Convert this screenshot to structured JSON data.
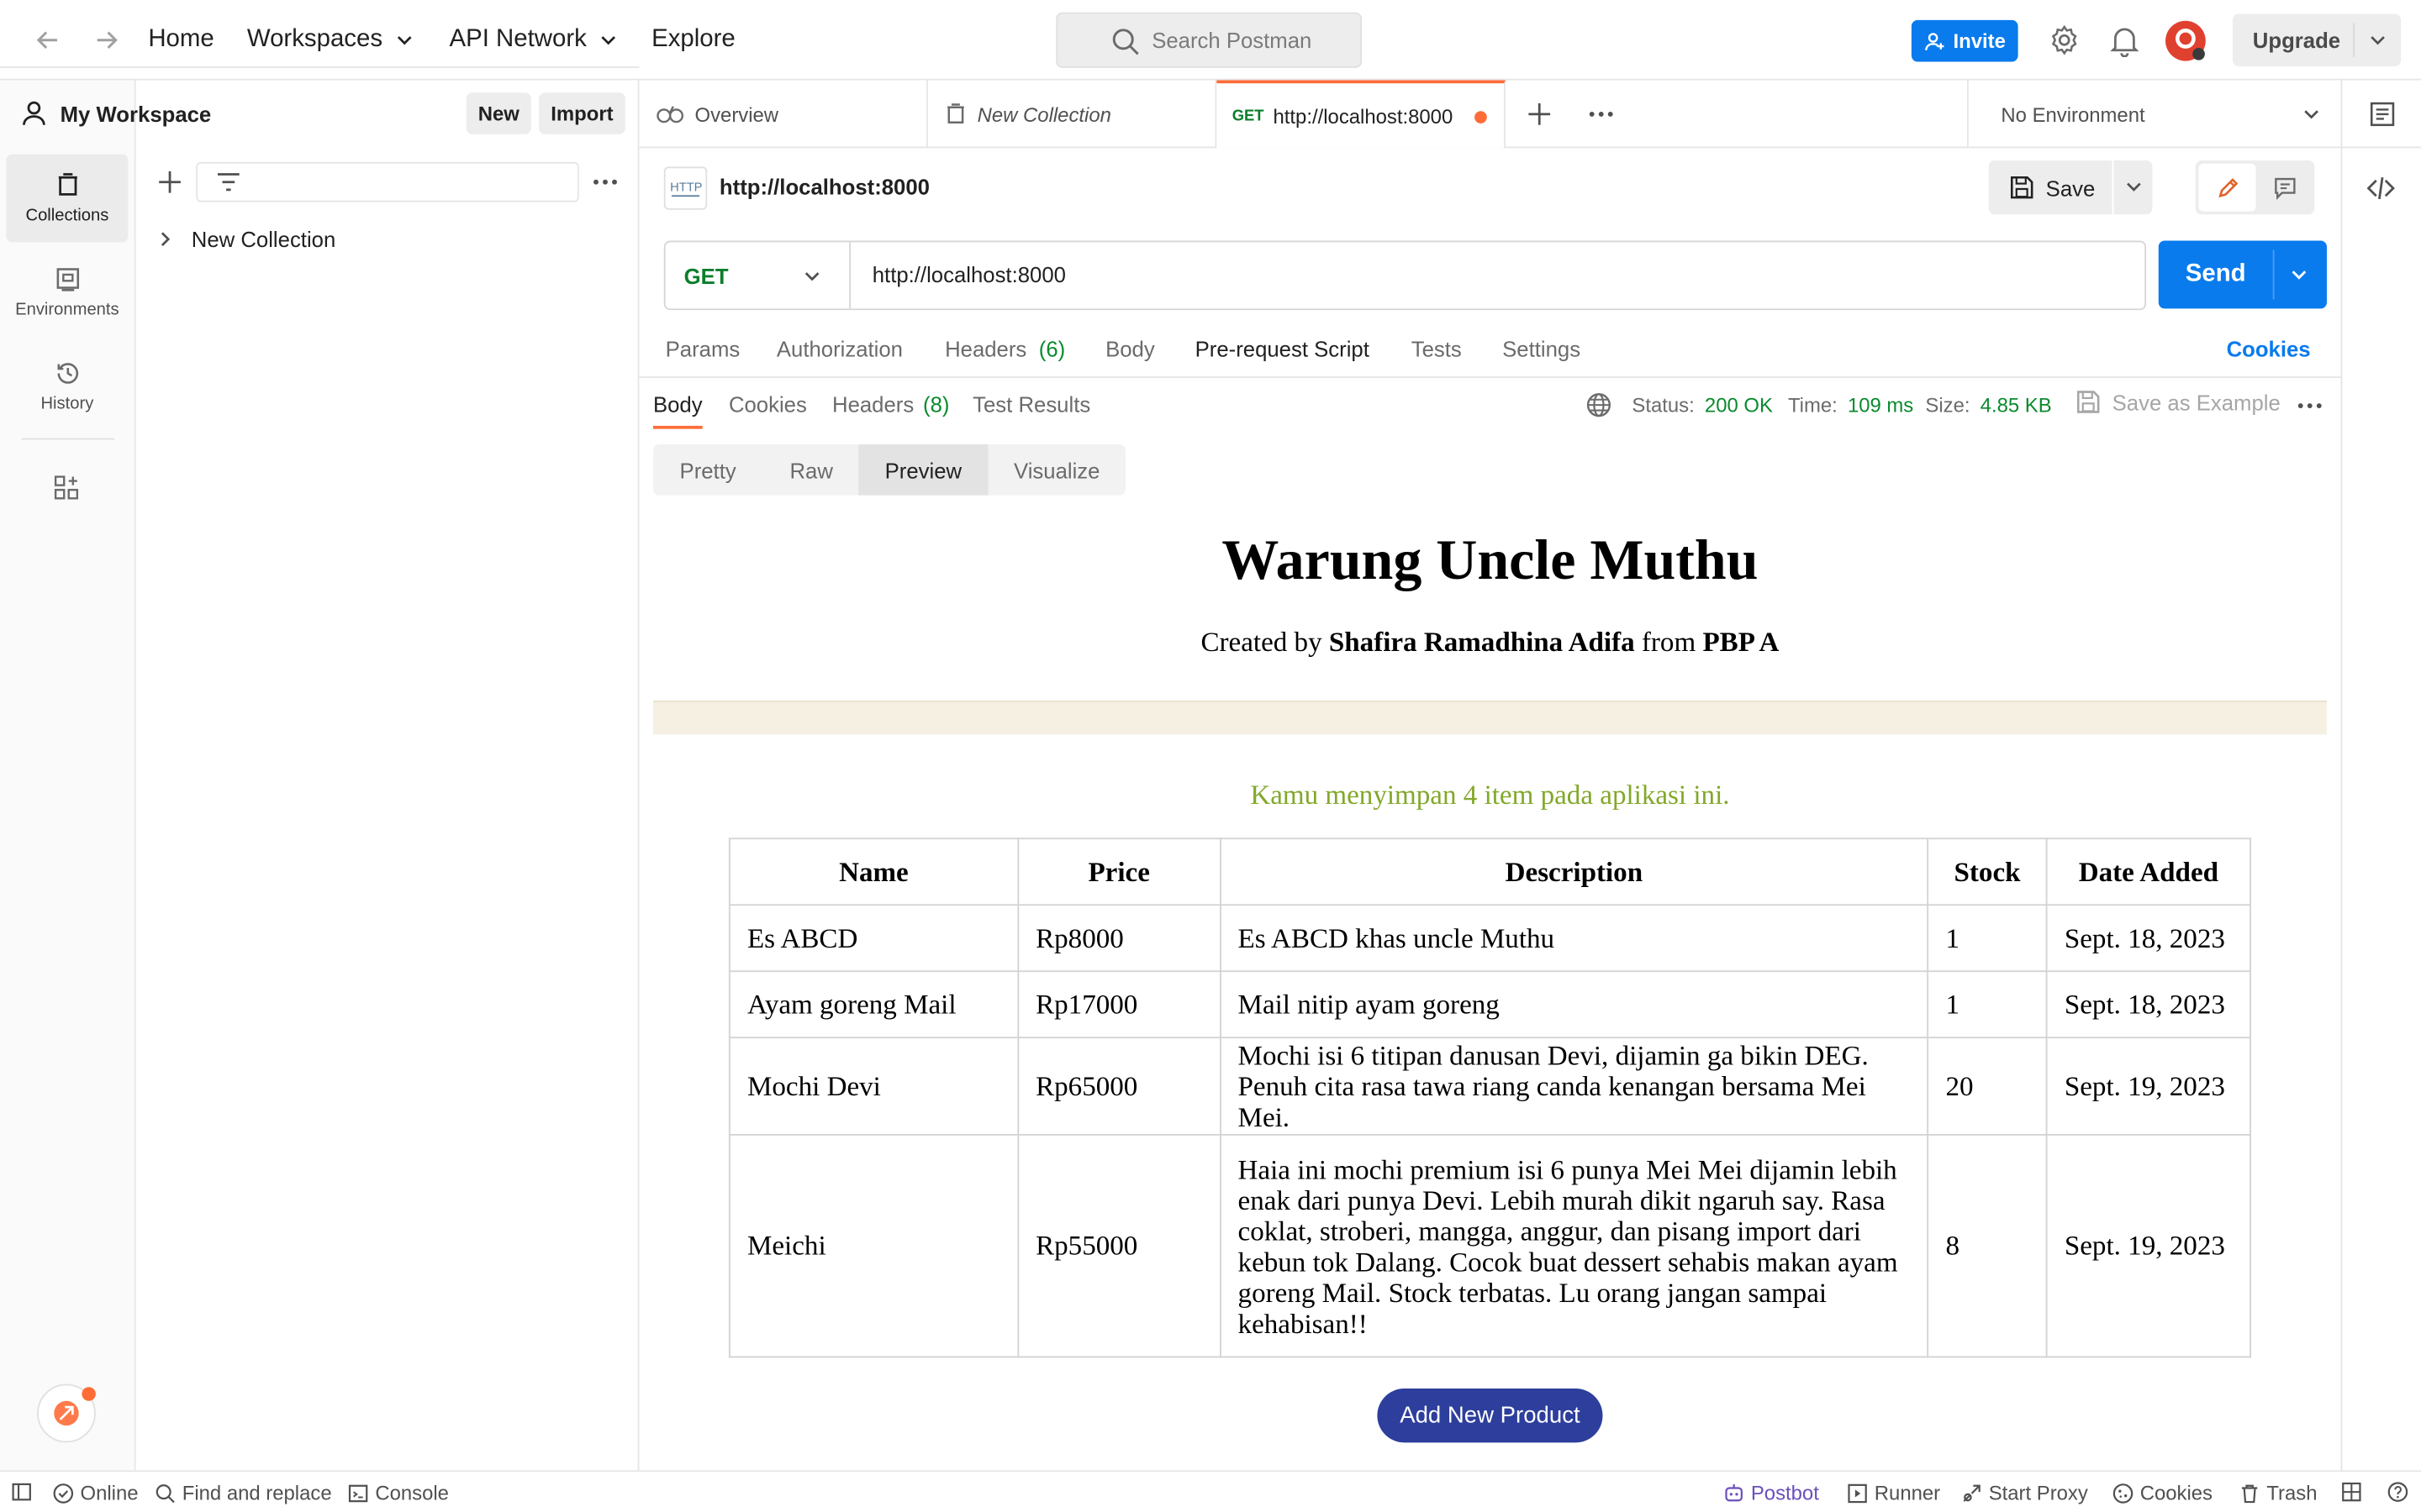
{
  "topbar": {
    "nav": [
      "Home",
      "Workspaces",
      "API Network",
      "Explore"
    ],
    "search_placeholder": "Search Postman",
    "invite_label": "Invite",
    "upgrade_label": "Upgrade",
    "accent_color": "#097bed",
    "brand_color": "#ff6c37"
  },
  "leftnav": {
    "items": [
      {
        "label": "Collections",
        "icon": "collections-icon",
        "active": true
      },
      {
        "label": "Environments",
        "icon": "environments-icon",
        "active": false
      },
      {
        "label": "History",
        "icon": "history-icon",
        "active": false
      }
    ]
  },
  "sidebar": {
    "workspace_name": "My Workspace",
    "new_label": "New",
    "import_label": "Import",
    "collections": [
      "New Collection"
    ]
  },
  "tabs": {
    "items": [
      {
        "label": "Overview",
        "method": ""
      },
      {
        "label": "New Collection",
        "method": ""
      },
      {
        "label": "http://localhost:8000",
        "method": "GET",
        "active": true,
        "unsaved": true
      }
    ],
    "environment": "No Environment"
  },
  "request": {
    "name": "http://localhost:8000",
    "method": "GET",
    "url": "http://localhost:8000",
    "save_label": "Save",
    "send_label": "Send",
    "tabs": [
      "Params",
      "Authorization",
      "Headers",
      "Body",
      "Pre-request Script",
      "Tests",
      "Settings"
    ],
    "headers_count": "(6)",
    "cookies_label": "Cookies"
  },
  "response": {
    "tabs": [
      "Body",
      "Cookies",
      "Headers",
      "Test Results"
    ],
    "headers_count": "(8)",
    "status_label": "Status:",
    "status": "200 OK",
    "time_label": "Time:",
    "time": "109 ms",
    "size_label": "Size:",
    "size": "4.85 KB",
    "save_example": "Save as Example",
    "views": [
      "Pretty",
      "Raw",
      "Preview",
      "Visualize"
    ],
    "active_view": "Preview"
  },
  "preview": {
    "title": "Warung Uncle Muthu",
    "subtitle_prefix": "Created by",
    "author": "Shafira Ramadhina Adifa",
    "subtitle_mid": "from",
    "class": "PBP A",
    "count_text": "Kamu menyimpan 4 item pada aplikasi ini.",
    "columns": [
      "Name",
      "Price",
      "Description",
      "Stock",
      "Date Added"
    ],
    "rows": [
      [
        "Es ABCD",
        "Rp8000",
        "Es ABCD khas uncle Muthu",
        "1",
        "Sept. 18, 2023"
      ],
      [
        "Ayam goreng Mail",
        "Rp17000",
        "Mail nitip ayam goreng",
        "1",
        "Sept. 18, 2023"
      ],
      [
        "Mochi Devi",
        "Rp65000",
        "Mochi isi 6 titipan danusan Devi, dijamin ga bikin DEG. Penuh cita rasa tawa riang canda kenangan bersama Mei Mei.",
        "20",
        "Sept. 19, 2023"
      ],
      [
        "Meichi",
        "Rp55000",
        "Haia ini mochi premium isi 6 punya Mei Mei dijamin lebih enak dari punya Devi. Lebih murah dikit ngaruh say. Rasa coklat, stroberi, mangga, anggur, dan pisang import dari kebun tok Dalang. Cocok buat dessert sehabis makan ayam goreng Mail. Stock terbatas. Lu orang jangan sampai kehabisan!!",
        "8",
        "Sept. 19, 2023"
      ]
    ],
    "add_button": "Add New Product"
  },
  "statusbar": {
    "left": [
      "Online",
      "Find and replace",
      "Console"
    ],
    "right": [
      "Postbot",
      "Runner",
      "Start Proxy",
      "Cookies",
      "Trash"
    ]
  }
}
